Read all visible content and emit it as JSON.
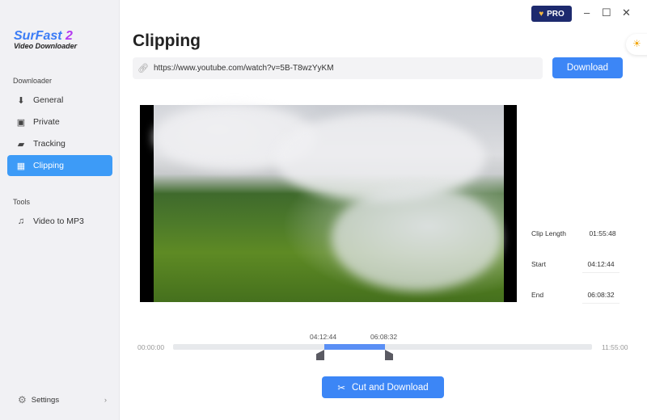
{
  "app": {
    "logo_main": "SurFast",
    "logo_num": "2",
    "logo_sub": "Video Downloader"
  },
  "titlebar": {
    "pro_label": "PRO",
    "minimize": "–",
    "maximize": "☐",
    "close": "✕"
  },
  "sidebar": {
    "section_downloader": "Downloader",
    "items": [
      {
        "label": "General",
        "icon": "⬇"
      },
      {
        "label": "Private",
        "icon": "▣"
      },
      {
        "label": "Tracking",
        "icon": "▰"
      },
      {
        "label": "Clipping",
        "icon": "▦"
      }
    ],
    "section_tools": "Tools",
    "tools": [
      {
        "label": "Video to MP3",
        "icon": "♫"
      }
    ],
    "settings": "Settings"
  },
  "main": {
    "title": "Clipping",
    "url": "https://www.youtube.com/watch?v=5B-T8wzYyKM",
    "download_label": "Download",
    "clip": {
      "length_label": "Clip Length",
      "length": "01:55:48",
      "start_label": "Start",
      "start": "04:12:44",
      "end_label": "End",
      "end": "06:08:32"
    },
    "timeline": {
      "min": "00:00:00",
      "max": "11:55:00",
      "start": "04:12:44",
      "end": "06:08:32"
    },
    "cut_label": "Cut and Download"
  },
  "colors": {
    "accent": "#3c86f6",
    "active_nav": "#3d9bf7",
    "pro_bg": "#1d2a6e"
  }
}
